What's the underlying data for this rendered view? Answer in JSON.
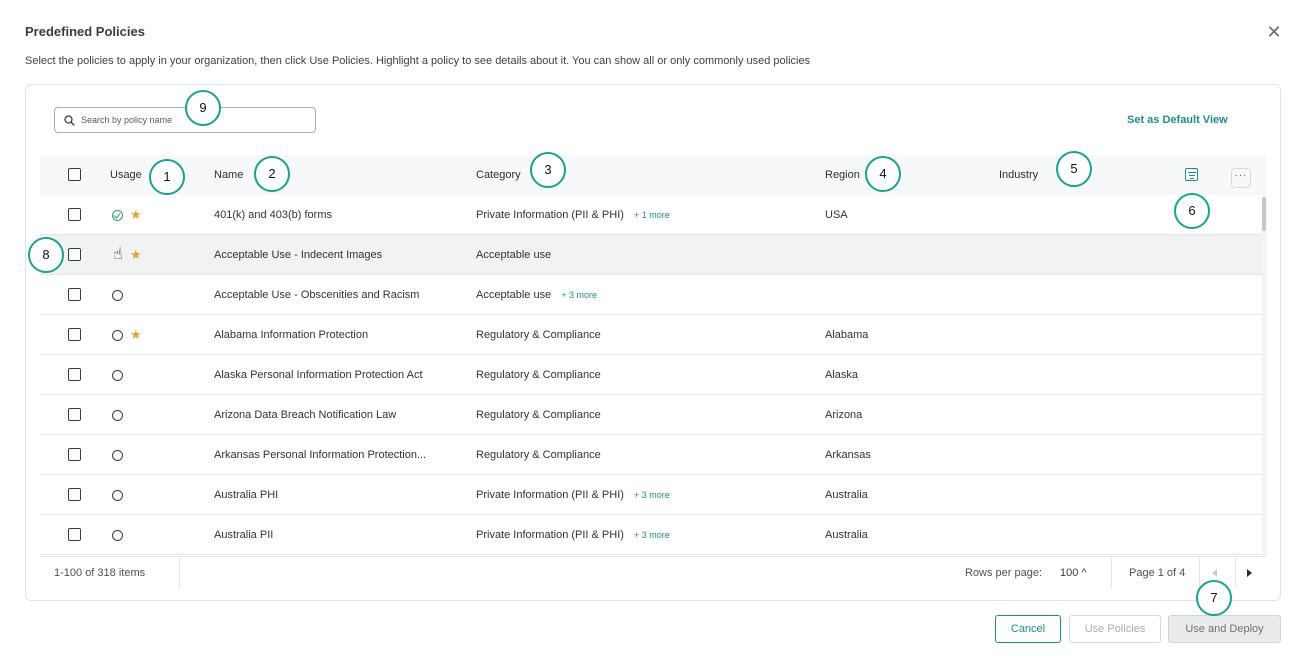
{
  "dialog": {
    "title": "Predefined Policies",
    "subtitle": "Select the policies to apply in your organization, then click Use Policies. Highlight a policy to see details about it. You can show all or only commonly used policies",
    "close_glyph": "✕"
  },
  "search": {
    "placeholder": "Search by policy name"
  },
  "set_default_view": "Set as Default View",
  "columns": {
    "usage": "Usage",
    "name": "Name",
    "category": "Category",
    "region": "Region",
    "industry": "Industry"
  },
  "more_glyph": "···",
  "rows": [
    {
      "usage": "check",
      "star": true,
      "name": "401(k) and 403(b) forms",
      "category": "Private Information (PII & PHI)",
      "more": "+ 1 more",
      "region": "USA"
    },
    {
      "usage": "hand",
      "star": true,
      "name": "Acceptable Use - Indecent Images",
      "category": "Acceptable use",
      "more": "",
      "region": ""
    },
    {
      "usage": "circle",
      "star": false,
      "name": "Acceptable Use - Obscenities and Racism",
      "category": "Acceptable use",
      "more": "+ 3 more",
      "region": ""
    },
    {
      "usage": "circle",
      "star": true,
      "name": "Alabama Information Protection",
      "category": "Regulatory & Compliance",
      "more": "",
      "region": "Alabama"
    },
    {
      "usage": "circle",
      "star": false,
      "name": "Alaska Personal Information Protection Act",
      "category": "Regulatory & Compliance",
      "more": "",
      "region": "Alaska"
    },
    {
      "usage": "circle",
      "star": false,
      "name": "Arizona Data Breach Notification Law",
      "category": "Regulatory & Compliance",
      "more": "",
      "region": "Arizona"
    },
    {
      "usage": "circle",
      "star": false,
      "name": "Arkansas Personal Information Protection...",
      "category": "Regulatory & Compliance",
      "more": "",
      "region": "Arkansas"
    },
    {
      "usage": "circle",
      "star": false,
      "name": "Australia PHI",
      "category": "Private Information (PII & PHI)",
      "more": "+ 3 more",
      "region": "Australia"
    },
    {
      "usage": "circle",
      "star": false,
      "name": "Australia PII",
      "category": "Private Information (PII & PHI)",
      "more": "+ 3 more",
      "region": "Australia"
    }
  ],
  "footer": {
    "items_count": "1-100 of 318 items",
    "rows_per_page_label": "Rows per page:",
    "rows_per_page_value": "100 ^",
    "page_label": "Page 1 of 4"
  },
  "annotations": [
    "1",
    "2",
    "3",
    "4",
    "5",
    "6",
    "7",
    "8",
    "9"
  ],
  "buttons": {
    "cancel": "Cancel",
    "use_policies": "Use Policies",
    "use_and_deploy": "Use and Deploy"
  },
  "colors": {
    "accent": "#1f8f84",
    "annotation_ring": "#1aa387",
    "star": "#e3a33b",
    "check": "#2a9d6f"
  }
}
